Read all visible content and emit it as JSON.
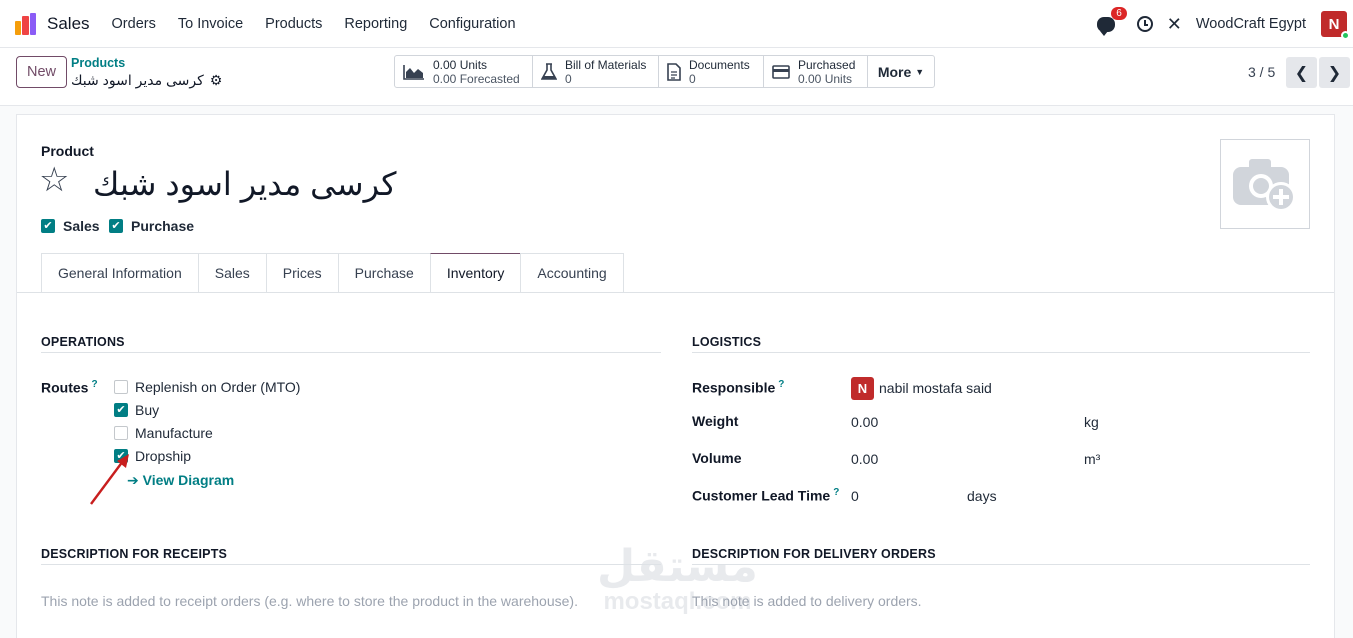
{
  "navbar": {
    "app_name": "Sales",
    "menu": [
      "Orders",
      "To Invoice",
      "Products",
      "Reporting",
      "Configuration"
    ],
    "chat_count": "6",
    "company": "WoodCraft Egypt",
    "user_initial": "N"
  },
  "control": {
    "new_label": "New",
    "breadcrumb": "Products",
    "record_title": "كرسى مدير اسود شبك",
    "smart_buttons": {
      "forecast": {
        "line1": "0.00 Units",
        "line2": "0.00 Forecasted"
      },
      "bom": {
        "line1": "Bill of Materials",
        "line2": "0"
      },
      "documents": {
        "line1": "Documents",
        "line2": "0"
      },
      "purchased": {
        "line1": "Purchased",
        "line2": "0.00 Units"
      },
      "more": "More"
    },
    "pager": "3 / 5"
  },
  "form": {
    "product_label": "Product",
    "product_name": "كرسى مدير اسود شبك",
    "sales_label": "Sales",
    "purchase_label": "Purchase",
    "tabs": [
      "General Information",
      "Sales",
      "Prices",
      "Purchase",
      "Inventory",
      "Accounting"
    ],
    "active_tab": "Inventory",
    "operations": {
      "title": "OPERATIONS",
      "routes_label": "Routes",
      "routes": [
        {
          "label": "Replenish on Order (MTO)",
          "checked": false
        },
        {
          "label": "Buy",
          "checked": true
        },
        {
          "label": "Manufacture",
          "checked": false
        },
        {
          "label": "Dropship",
          "checked": true
        }
      ],
      "view_diagram": "View Diagram"
    },
    "logistics": {
      "title": "LOGISTICS",
      "responsible_label": "Responsible",
      "responsible_initial": "N",
      "responsible": "nabil mostafa said",
      "weight_label": "Weight",
      "weight": "0.00",
      "weight_unit": "kg",
      "volume_label": "Volume",
      "volume": "0.00",
      "volume_unit": "m³",
      "lead_time_label": "Customer Lead Time",
      "lead_time": "0",
      "lead_time_unit": "days"
    },
    "receipts": {
      "title": "DESCRIPTION FOR RECEIPTS",
      "placeholder": "This note is added to receipt orders (e.g. where to store the product in the warehouse)."
    },
    "delivery": {
      "title": "DESCRIPTION FOR DELIVERY ORDERS",
      "placeholder": "This note is added to delivery orders."
    }
  },
  "watermark": {
    "arabic": "مستقل",
    "latin": "mostaql.com"
  }
}
